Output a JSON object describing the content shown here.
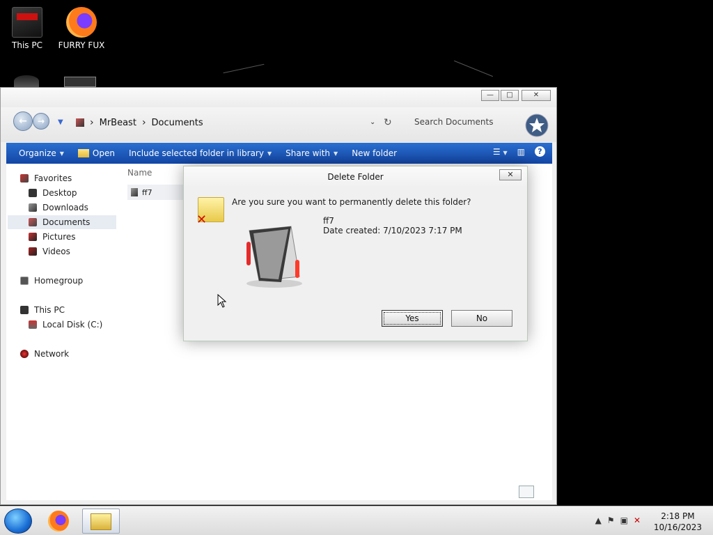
{
  "desktop": {
    "icons": [
      {
        "label": "This PC"
      },
      {
        "label": "FURRY FUX"
      }
    ]
  },
  "window": {
    "min_glyph": "—",
    "max_glyph": "□",
    "close_glyph": "✕"
  },
  "address": {
    "back_glyph": "←",
    "forward_glyph": "→",
    "crumbs": [
      "MrBeast",
      "Documents"
    ],
    "search_placeholder": "Search Documents"
  },
  "toolbar": {
    "organize": "Organize",
    "open": "Open",
    "include": "Include selected folder in library",
    "share": "Share with",
    "new_folder": "New folder"
  },
  "nav": {
    "favorites": "Favorites",
    "desktop": "Desktop",
    "downloads": "Downloads",
    "documents": "Documents",
    "pictures": "Pictures",
    "videos": "Videos",
    "homegroup": "Homegroup",
    "this_pc": "This PC",
    "local_disk": "Local Disk (C:)",
    "network": "Network"
  },
  "files": {
    "column_name": "Name",
    "rows": [
      {
        "name": "ff7"
      }
    ]
  },
  "dialog": {
    "title": "Delete Folder",
    "question": "Are you sure you want to permanently delete this folder?",
    "item_name": "ff7",
    "date_created": "Date created: 7/10/2023 7:17 PM",
    "yes": "Yes",
    "no": "No",
    "close_glyph": "✕"
  },
  "taskbar": {
    "time": "2:18 PM",
    "date": "10/16/2023"
  },
  "colors": {
    "toolbar": "#1e5bbd",
    "desktop": "#000000",
    "selected": "#e7ecf3"
  }
}
